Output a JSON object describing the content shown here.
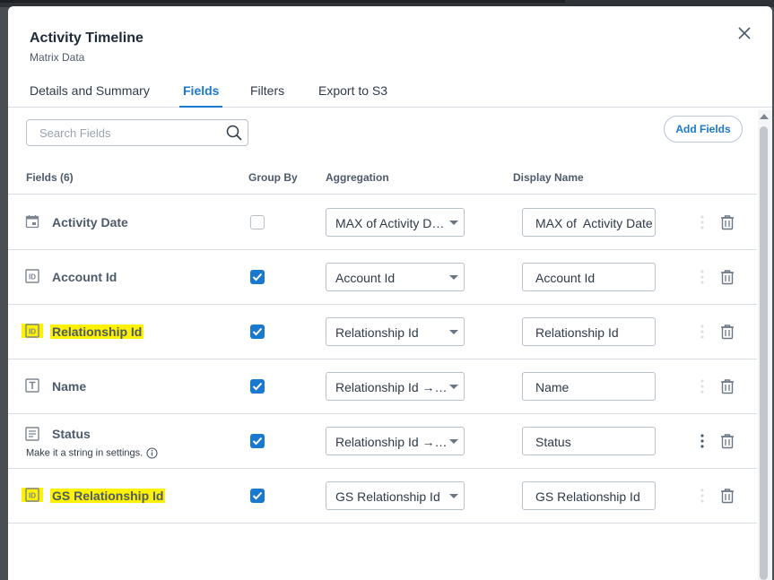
{
  "modal": {
    "title": "Activity Timeline",
    "subtitle": "Matrix Data"
  },
  "tabs": [
    {
      "label": "Details and Summary",
      "active": false
    },
    {
      "label": "Fields",
      "active": true
    },
    {
      "label": "Filters",
      "active": false
    },
    {
      "label": "Export to S3",
      "active": false
    }
  ],
  "search": {
    "placeholder": "Search Fields",
    "value": ""
  },
  "add_fields_label": "Add Fields",
  "columns": {
    "fields": "Fields (6)",
    "group_by": "Group By",
    "aggregation": "Aggregation",
    "display_name": "Display Name"
  },
  "rows": [
    {
      "icon": "calendar-icon",
      "name": "Activity Date",
      "subtext": "",
      "highlighted": false,
      "group_by": false,
      "aggregation": "MAX of Activity Date",
      "display_name": "MAX of  Activity Date",
      "kebab_active": false
    },
    {
      "icon": "id-icon",
      "name": "Account Id",
      "subtext": "",
      "highlighted": false,
      "group_by": true,
      "aggregation": "Account Id",
      "display_name": "Account Id",
      "kebab_active": false
    },
    {
      "icon": "id-icon",
      "name": "Relationship Id",
      "subtext": "",
      "highlighted": true,
      "group_by": true,
      "aggregation": "Relationship Id",
      "display_name": "Relationship Id",
      "kebab_active": false
    },
    {
      "icon": "text-icon",
      "name": "Name",
      "subtext": "",
      "highlighted": false,
      "group_by": true,
      "aggregation": "Relationship Id → Name",
      "display_name": "Name",
      "kebab_active": false
    },
    {
      "icon": "list-icon",
      "name": "Status",
      "subtext": "Make it a string in settings.",
      "highlighted": false,
      "group_by": true,
      "aggregation": "Relationship Id → Status",
      "display_name": "Status",
      "kebab_active": true
    },
    {
      "icon": "id-icon",
      "name": "GS Relationship Id",
      "subtext": "",
      "highlighted": true,
      "group_by": true,
      "aggregation": "GS Relationship Id",
      "display_name": "GS Relationship Id",
      "kebab_active": false
    }
  ],
  "colors": {
    "accent": "#1979cf",
    "highlight": "#fff200",
    "text_muted": "#4c5a6b"
  }
}
